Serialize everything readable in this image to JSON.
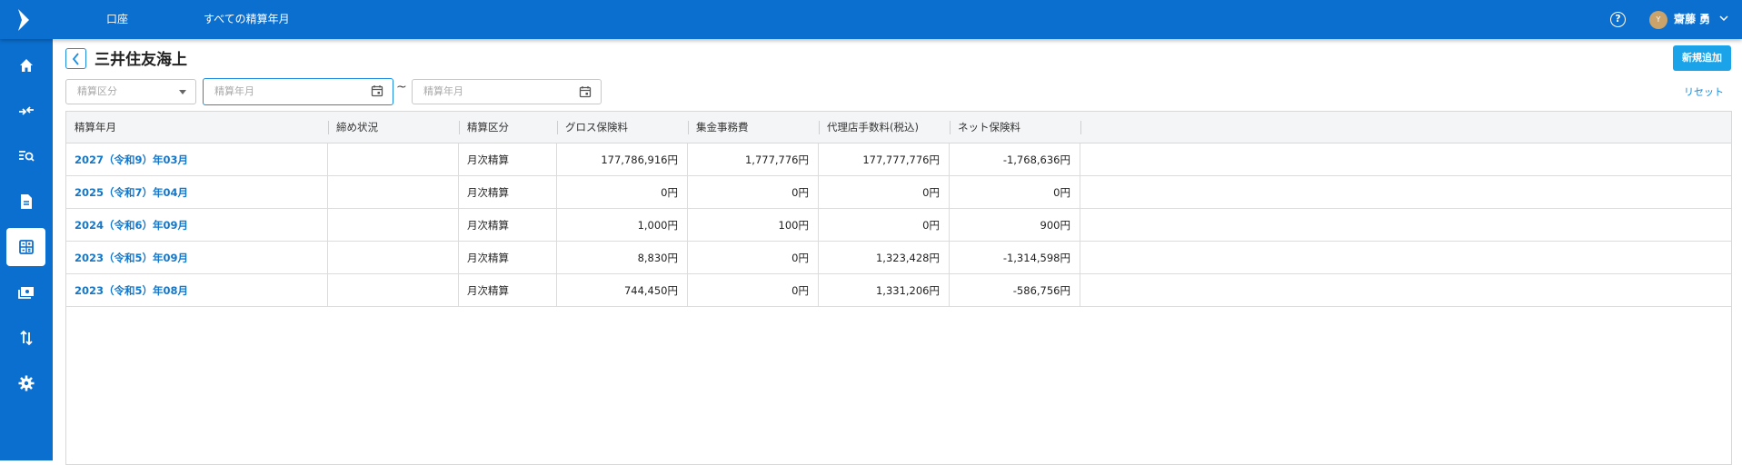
{
  "topbar": {
    "nav": [
      "口座",
      "すべての精算年月"
    ],
    "avatar_initial": "Y",
    "user_name": "齋藤 勇"
  },
  "sidebar": {
    "items": [
      {
        "icon": "home-icon"
      },
      {
        "icon": "transfer-icon"
      },
      {
        "icon": "search-list-icon"
      },
      {
        "icon": "document-icon"
      },
      {
        "icon": "calculator-icon",
        "active": true
      },
      {
        "icon": "payment-icon"
      },
      {
        "icon": "sort-arrows-icon"
      },
      {
        "icon": "gear-icon"
      }
    ]
  },
  "page": {
    "title": "三井住友海上",
    "new_button": "新規追加",
    "reset_label": "リセット"
  },
  "filters": {
    "kubun_placeholder": "精算区分",
    "from_placeholder": "精算年月",
    "to_placeholder": "精算年月",
    "separator": "~"
  },
  "table": {
    "headers": [
      "精算年月",
      "締め状況",
      "精算区分",
      "グロス保険料",
      "集金事務費",
      "代理店手数料(税込)",
      "ネット保険料"
    ],
    "rows": [
      [
        "2027（令和9）年03月",
        "",
        "月次精算",
        "177,786,916円",
        "1,777,776円",
        "177,777,776円",
        "-1,768,636円"
      ],
      [
        "2025（令和7）年04月",
        "",
        "月次精算",
        "0円",
        "0円",
        "0円",
        "0円"
      ],
      [
        "2024（令和6）年09月",
        "",
        "月次精算",
        "1,000円",
        "100円",
        "0円",
        "900円"
      ],
      [
        "2023（令和5）年09月",
        "",
        "月次精算",
        "8,830円",
        "0円",
        "1,323,428円",
        "-1,314,598円"
      ],
      [
        "2023（令和5）年08月",
        "",
        "月次精算",
        "744,450円",
        "0円",
        "1,331,206円",
        "-586,756円"
      ]
    ]
  },
  "colors": {
    "brand": "#0b6fd0",
    "accent": "#1aa3e8",
    "link": "#1477c9"
  }
}
